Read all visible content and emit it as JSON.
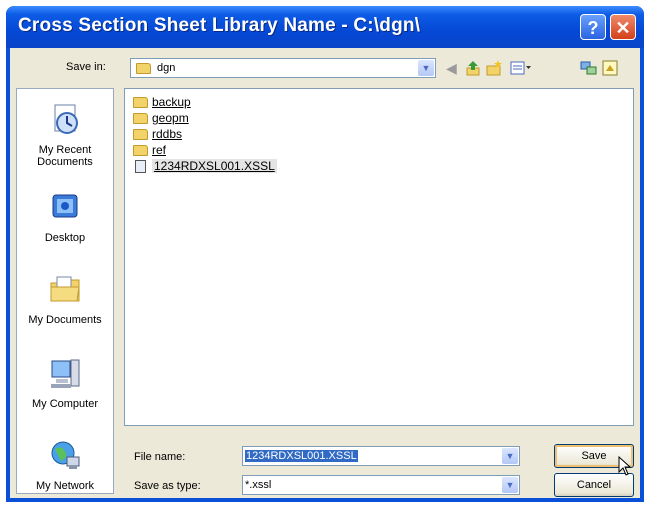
{
  "window": {
    "title": "Cross Section Sheet Library Name - C:\\dgn\\",
    "help_glyph": "?",
    "close_glyph": "✕"
  },
  "toolbar": {
    "save_in_label": "Save in:",
    "save_in_value": "dgn",
    "icons": [
      "back-icon",
      "up-folder-icon",
      "new-folder-icon",
      "view-menu-icon",
      "network-icon",
      "properties-icon"
    ]
  },
  "places": [
    {
      "label1": "My Recent",
      "label2": "Documents",
      "icon": "recent-documents-icon"
    },
    {
      "label1": "Desktop",
      "label2": "",
      "icon": "desktop-icon"
    },
    {
      "label1": "My Documents",
      "label2": "",
      "icon": "my-documents-icon"
    },
    {
      "label1": "My Computer",
      "label2": "",
      "icon": "my-computer-icon"
    },
    {
      "label1": "My Network",
      "label2": "",
      "icon": "my-network-icon"
    }
  ],
  "files": [
    {
      "name": "backup",
      "type": "folder"
    },
    {
      "name": "geopm",
      "type": "folder"
    },
    {
      "name": "rddbs",
      "type": "folder"
    },
    {
      "name": "ref",
      "type": "folder"
    },
    {
      "name": "1234RDXSL001.XSSL",
      "type": "file"
    }
  ],
  "form": {
    "file_name_label": "File name:",
    "file_name_value": "1234RDXSL001.XSSL",
    "save_type_label": "Save as type:",
    "save_type_value": "*.xssl",
    "save_label": "Save",
    "cancel_label": "Cancel"
  }
}
